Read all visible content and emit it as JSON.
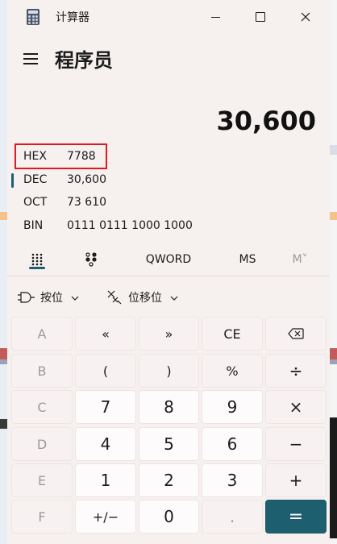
{
  "window": {
    "title": "计算器",
    "minimize_label": "minimize",
    "maximize_label": "maximize",
    "close_label": "close"
  },
  "header": {
    "mode_title": "程序员"
  },
  "display": {
    "value": "30,600"
  },
  "radix": [
    {
      "label": "HEX",
      "value": "7788"
    },
    {
      "label": "DEC",
      "value": "30,600"
    },
    {
      "label": "OCT",
      "value": "73 610"
    },
    {
      "label": "BIN",
      "value": "0111 0111 1000 1000"
    }
  ],
  "mode_bar": {
    "word_size": "QWORD",
    "ms": "MS",
    "m_list": "M˅"
  },
  "dropdowns": {
    "bitwise": "按位",
    "bitshift": "位移位"
  },
  "keys": [
    [
      "A",
      "«",
      "»",
      "CE",
      "⌫"
    ],
    [
      "B",
      "(",
      ")",
      "%",
      "÷"
    ],
    [
      "C",
      "7",
      "8",
      "9",
      "×"
    ],
    [
      "D",
      "4",
      "5",
      "6",
      "−"
    ],
    [
      "E",
      "1",
      "2",
      "3",
      "+"
    ],
    [
      "F",
      "+/−",
      "0",
      ".",
      "="
    ]
  ],
  "colors": {
    "accent": "#1e5f6f",
    "highlight": "#e0181f",
    "window_bg": "#f6f0ee"
  }
}
